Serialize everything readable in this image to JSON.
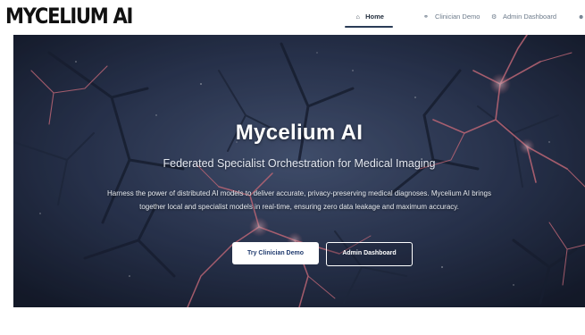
{
  "brand": {
    "logo_text": "MYCELIUM AI"
  },
  "nav": {
    "items": [
      {
        "label": "Home",
        "icon": "home-icon",
        "active": true
      },
      {
        "label": "Clinician Demo",
        "icon": "stethoscope-icon",
        "active": false
      },
      {
        "label": "Admin Dashboard",
        "icon": "gear-icon",
        "active": false
      },
      {
        "label": "",
        "icon": "user-icon",
        "active": false
      }
    ]
  },
  "hero": {
    "title": "Mycelium AI",
    "subtitle": "Federated Specialist Orchestration for Medical Imaging",
    "description": "Harness the power of distributed AI models to deliver accurate, privacy-preserving medical diagnoses. Mycelium AI brings together local and specialist models in real-time, ensuring zero data leakage and maximum accuracy.",
    "primary_button": "Try Clinician Demo",
    "secondary_button": "Admin Dashboard"
  },
  "colors": {
    "accent": "#1f3a6e",
    "hero_bg": "#243047",
    "neuron": "#e0707f"
  }
}
